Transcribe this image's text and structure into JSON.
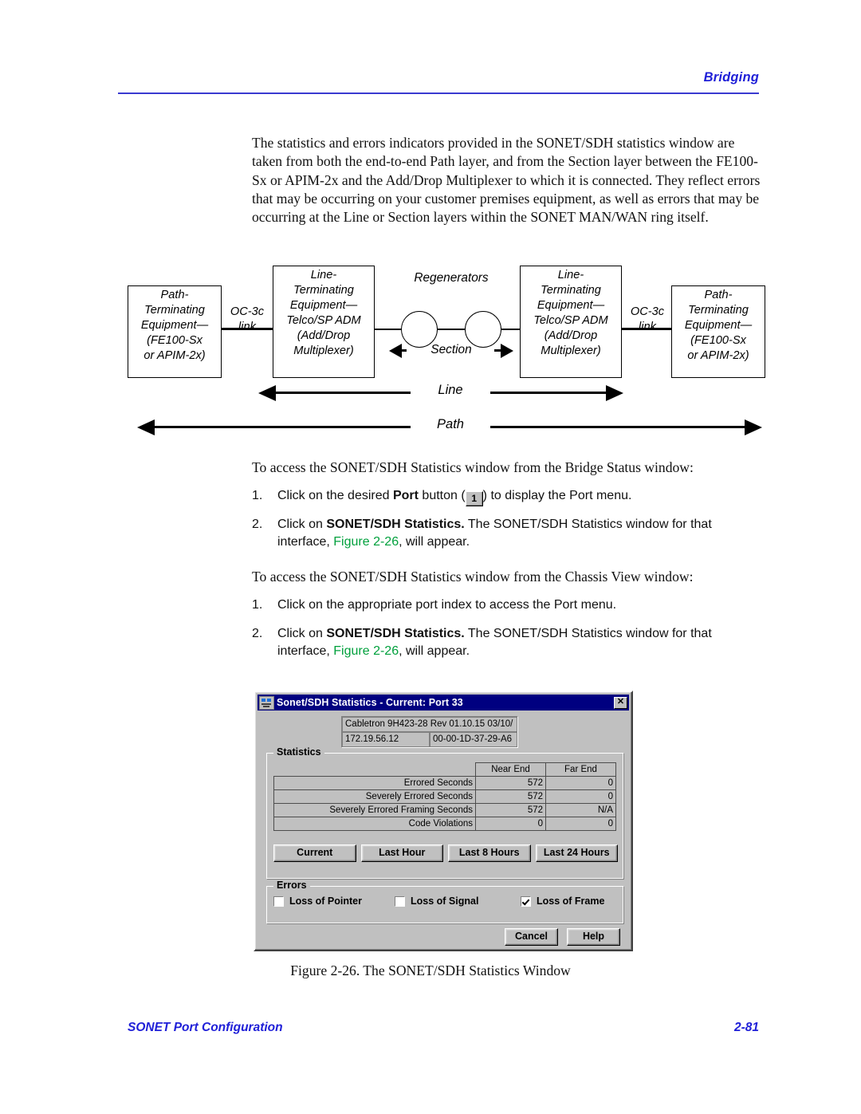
{
  "header": {
    "title": "Bridging"
  },
  "intro": {
    "paragraph": "The statistics and errors indicators provided in the SONET/SDH statistics window are taken from both the end-to-end Path layer, and from the Section layer between the FE100-Sx or APIM-2x and the Add/Drop Multiplexer to which it is connected. They reflect errors that may be occurring on your customer premises equipment, as well as errors that may be occurring at the Line or Section layers within the SONET MAN/WAN ring itself."
  },
  "diagram": {
    "boxes": {
      "pte_left": "Path-\nTerminating\nEquipment—\n(FE100-Sx\nor APIM-2x)",
      "lte_left": "Line-\nTerminating\nEquipment—\nTelco/SP ADM\n(Add/Drop\nMultiplexer)",
      "lte_right": "Line-\nTerminating\nEquipment—\nTelco/SP ADM\n(Add/Drop\nMultiplexer)",
      "pte_right": "Path-\nTerminating\nEquipment—\n(FE100-Sx\nor APIM-2x)"
    },
    "labels": {
      "oc3c_left": "OC-3c\nlink",
      "oc3c_right": "OC-3c\nlink",
      "regenerators": "Regenerators",
      "section": "Section",
      "line": "Line",
      "path": "Path"
    }
  },
  "access_bridge": {
    "lead": "To access the SONET/SDH Statistics window from the Bridge Status window:",
    "steps": [
      {
        "num": "1.",
        "pre": "Click on the desired ",
        "bold": "Port",
        "mid": " button (",
        "glyph": "1",
        "post": ") to display the Port menu."
      },
      {
        "num": "2.",
        "pre": "Click on ",
        "bold": "SONET/SDH Statistics.",
        "mid": " The SONET/SDH Statistics window for that interface, ",
        "figref": "Figure 2-26",
        "post": ", will appear."
      }
    ]
  },
  "access_chassis": {
    "lead": "To access the SONET/SDH Statistics window from the Chassis View window:",
    "steps": [
      {
        "num": "1.",
        "pre": "Click on the appropriate port index to access the Port menu.",
        "bold": "",
        "mid": "",
        "figref": "",
        "post": ""
      },
      {
        "num": "2.",
        "pre": "Click on ",
        "bold": "SONET/SDH Statistics.",
        "mid": " The SONET/SDH Statistics window for that interface, ",
        "figref": "Figure 2-26",
        "post": ", will appear."
      }
    ]
  },
  "dialog": {
    "title": "Sonet/SDH Statistics - Current: Port 33",
    "close_label": "✕",
    "device": {
      "description": "Cabletron 9H423-28 Rev 01.10.15  03/10/",
      "ip_address": "172.19.56.12",
      "mac_address": "00-00-1D-37-29-A6"
    },
    "statistics": {
      "group_title": "Statistics",
      "columns": [
        "Near End",
        "Far End"
      ],
      "rows": [
        {
          "label": "Errored Seconds",
          "near_end": "572",
          "far_end": "0"
        },
        {
          "label": "Severely Errored Seconds",
          "near_end": "572",
          "far_end": "0"
        },
        {
          "label": "Severely Errored Framing Seconds",
          "near_end": "572",
          "far_end": "N/A"
        },
        {
          "label": "Code Violations",
          "near_end": "0",
          "far_end": "0"
        }
      ],
      "period_buttons": [
        "Current",
        "Last Hour",
        "Last 8 Hours",
        "Last 24 Hours"
      ]
    },
    "errors": {
      "group_title": "Errors",
      "checkboxes": [
        {
          "label": "Loss of Pointer",
          "checked": false
        },
        {
          "label": "Loss of Signal",
          "checked": false
        },
        {
          "label": "Loss of Frame",
          "checked": true
        }
      ]
    },
    "footer_buttons": {
      "cancel": "Cancel",
      "help": "Help"
    }
  },
  "figure": {
    "caption": "Figure 2-26.  The SONET/SDH Statistics Window"
  },
  "footer": {
    "left": "SONET Port Configuration",
    "right": "2-81"
  },
  "colors": {
    "header_blue": "#2020d8",
    "figure_link_green": "#00a03c",
    "titlebar_navy": "#000080",
    "dialog_face": "#c0c0c0"
  }
}
